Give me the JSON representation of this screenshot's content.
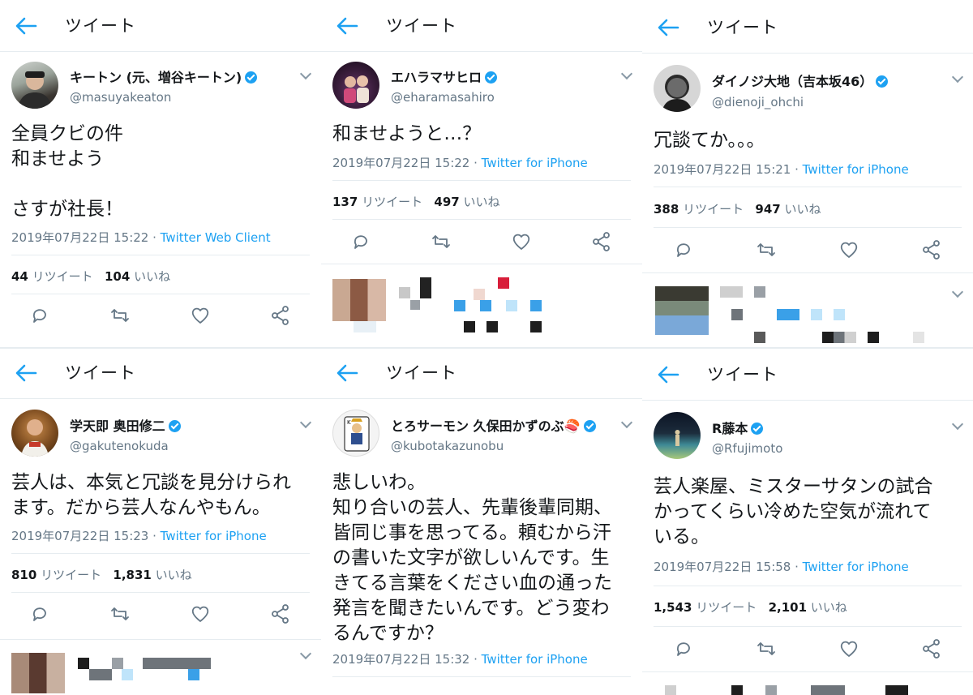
{
  "header_title": "ツイート",
  "separator": " · ",
  "colors": {
    "link": "#1da1f2",
    "muted": "#657786",
    "divider": "#e6ecf0",
    "verified": "#1da1f2"
  },
  "icons": [
    "back-arrow-icon",
    "verified-badge-icon",
    "chevron-down-icon",
    "reply-icon",
    "retweet-icon",
    "like-icon",
    "share-icon"
  ],
  "tweets": [
    {
      "name": "キートン (元、増谷キートン)",
      "handle": "@masuyakeaton",
      "text": "全員クビの件\n和ませよう\n\nさすが社長！",
      "datetime": "2019年07月22日 15:22",
      "source": "Twitter Web Client",
      "retweets": "44",
      "retweets_label": "リツイート",
      "likes": "104",
      "likes_label": "いいね"
    },
    {
      "name": "エハラマサヒロ",
      "handle": "@eharamasahiro",
      "text": "和ませようと…？",
      "datetime": "2019年07月22日 15:22",
      "source": "Twitter for iPhone",
      "retweets": "137",
      "retweets_label": "リツイート",
      "likes": "497",
      "likes_label": "いいね"
    },
    {
      "name": "ダイノジ大地（吉本坂46）",
      "handle": "@dienoji_ohchi",
      "text": "冗談てか。。。",
      "datetime": "2019年07月22日 15:21",
      "source": "Twitter for iPhone",
      "retweets": "388",
      "retweets_label": "リツイート",
      "likes": "947",
      "likes_label": "いいね"
    },
    {
      "name": "学天即 奥田修二",
      "handle": "@gakutenokuda",
      "text": "芸人は、本気と冗談を見分けられ\nます。だから芸人なんやもん。",
      "datetime": "2019年07月22日 15:23",
      "source": "Twitter for iPhone",
      "retweets": "810",
      "retweets_label": "リツイート",
      "likes": "1,831",
      "likes_label": "いいね"
    },
    {
      "name": "とろサーモン 久保田かずのぶ🍣",
      "handle": "@kubotakazunobu",
      "text": "悲しいわ。\n知り合いの芸人、先輩後輩同期、\n皆同じ事を思ってる。頼むから汗\nの書いた文字が欲しいんです。生\nきてる言葉をください血の通った\n発言を聞きたいんです。どう変わ\nるんですか？",
      "datetime": "2019年07月22日 15:32",
      "source": "Twitter for iPhone",
      "retweets": "",
      "retweets_label": "",
      "likes": "",
      "likes_label": ""
    },
    {
      "name": "R藤本",
      "handle": "@Rfujimoto",
      "text": "芸人楽屋、ミスターサタンの試合\nかってくらい冷めた空気が流れて\nいる。",
      "datetime": "2019年07月22日 15:58",
      "source": "Twitter for iPhone",
      "retweets": "1,543",
      "retweets_label": "リツイート",
      "likes": "2,101",
      "likes_label": "いいね"
    }
  ]
}
